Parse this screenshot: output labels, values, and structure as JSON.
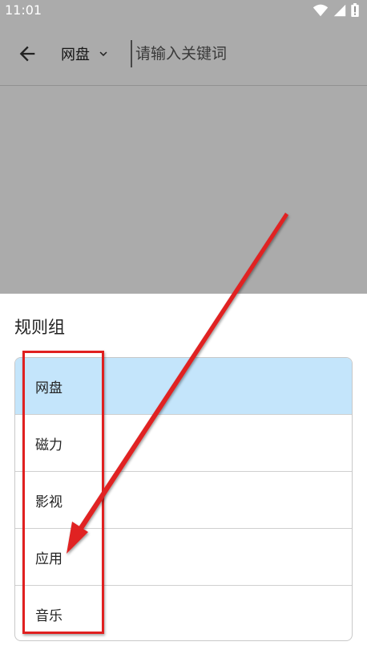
{
  "status_bar": {
    "time": "11:01"
  },
  "toolbar": {
    "dropdown_label": "网盘",
    "search_placeholder": "请输入关键词"
  },
  "sheet": {
    "title": "规则组",
    "items": [
      {
        "label": "网盘",
        "selected": true
      },
      {
        "label": "磁力",
        "selected": false
      },
      {
        "label": "影视",
        "selected": false
      },
      {
        "label": "应用",
        "selected": false
      },
      {
        "label": "音乐",
        "selected": false
      }
    ]
  },
  "colors": {
    "selected_item_bg": "#c4e5fb",
    "annotation_red": "#e02020",
    "scrim": "rgba(0,0,0,0.33)"
  },
  "icons": [
    "wifi-icon",
    "signal-icon",
    "battery-icon",
    "back-arrow-icon",
    "chevron-down-icon"
  ]
}
